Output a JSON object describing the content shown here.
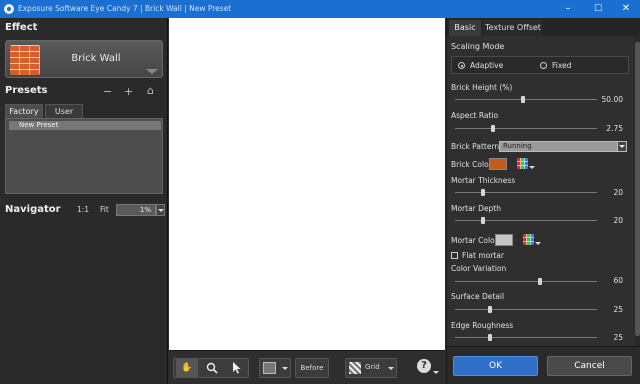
{
  "window": {
    "title": "Exposure Software Eye Candy 7 | Brick Wall | New Preset",
    "minimize": "–",
    "maximize": "☐",
    "close": "✕",
    "accent": "#1a6fd0"
  },
  "effect": {
    "heading": "Effect",
    "name": "Brick Wall"
  },
  "presets": {
    "heading": "Presets",
    "remove": "−",
    "add": "+",
    "home": "⌂",
    "tabs": [
      "Factory",
      "User"
    ],
    "items": [
      "New Preset"
    ]
  },
  "navigator": {
    "heading": "Navigator",
    "actual": "1:1",
    "fit": "Fit",
    "zoom": "1%"
  },
  "toolbar": {
    "before": "Before",
    "grid": "Grid",
    "help": "?"
  },
  "settings": {
    "tabs": [
      "Basic",
      "Texture Offset"
    ],
    "scaling_mode": {
      "label": "Scaling Mode",
      "options": [
        "Adaptive",
        "Fixed"
      ],
      "selected": "Adaptive"
    },
    "brick_height": {
      "label": "Brick Height (%)",
      "value": "50.00",
      "fraction": 0.48
    },
    "aspect_ratio": {
      "label": "Aspect Ratio",
      "value": "2.75",
      "fraction": 0.26
    },
    "brick_pattern": {
      "label": "Brick Pattern",
      "value": "Running"
    },
    "brick_color": {
      "label": "Brick Color",
      "color": "#c65a1c"
    },
    "mortar_thickness": {
      "label": "Mortar Thickness",
      "value": "20",
      "fraction": 0.19
    },
    "mortar_depth": {
      "label": "Mortar Depth",
      "value": "20",
      "fraction": 0.19
    },
    "mortar_color": {
      "label": "Mortar Color",
      "color": "#c8c8c8"
    },
    "flat_mortar": {
      "label": "Flat mortar",
      "checked": false
    },
    "color_variation": {
      "label": "Color Variation",
      "value": "60",
      "fraction": 0.6
    },
    "surface_detail": {
      "label": "Surface Detail",
      "value": "25",
      "fraction": 0.24
    },
    "edge_roughness": {
      "label": "Edge Roughness",
      "value": "25",
      "fraction": 0.24
    }
  },
  "dialog": {
    "ok": "OK",
    "cancel": "Cancel"
  }
}
